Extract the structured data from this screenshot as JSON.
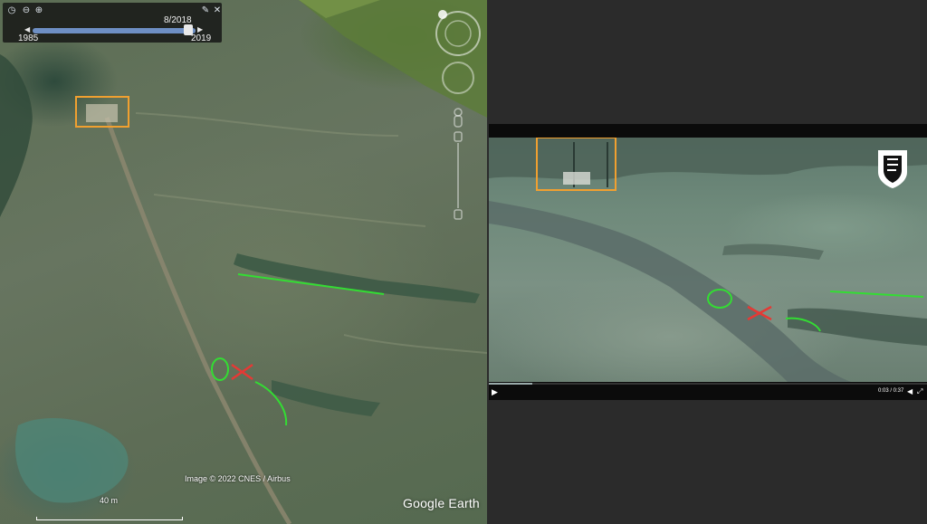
{
  "google_earth": {
    "timebar": {
      "current_date": "8/2018",
      "start_year": "1985",
      "end_year": "2019"
    },
    "attribution": "Image © 2022 CNES / Airbus",
    "scale_label": "40 m",
    "logo": "Google Earth"
  },
  "video": {
    "time": "0:03 / 0:37",
    "progress": 0.1
  },
  "colors": {
    "box": "#f0a030",
    "green_marker": "#33dd33",
    "red_marker": "#e53935"
  }
}
